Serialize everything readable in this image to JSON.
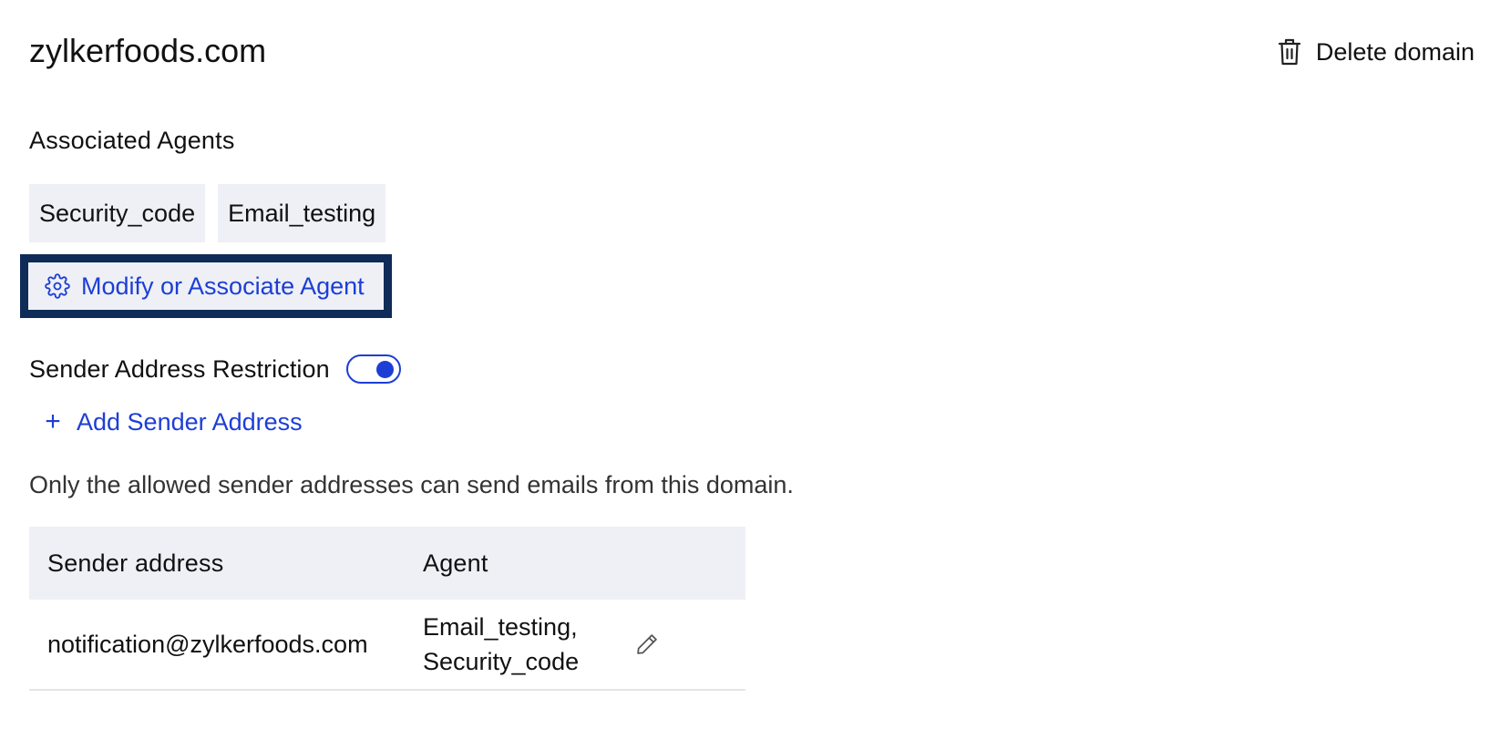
{
  "header": {
    "domain_title": "zylkerfoods.com",
    "delete_label": "Delete domain",
    "delete_icon": "trash-icon"
  },
  "associated_agents": {
    "heading": "Associated Agents",
    "agents": [
      "Security_code",
      "Email_testing"
    ],
    "modify_label": "Modify or Associate Agent",
    "modify_icon": "gear-icon"
  },
  "sender_restriction": {
    "label": "Sender Address Restriction",
    "enabled": true,
    "add_label": "Add Sender Address",
    "add_icon": "plus-icon",
    "info_text": "Only the allowed sender addresses can send emails from this domain."
  },
  "table": {
    "columns": [
      "Sender address",
      "Agent"
    ],
    "rows": [
      {
        "sender": "notification@zylkerfoods.com",
        "agents": "Email_testing,\nSecurity_code",
        "agents_line1": "Email_testing,",
        "agents_line2": "Security_code",
        "action_icon": "pencil-icon"
      }
    ]
  },
  "colors": {
    "accent": "#1d3ed6",
    "focus_border": "#0f2b57",
    "chip_bg": "#eef0f5"
  }
}
